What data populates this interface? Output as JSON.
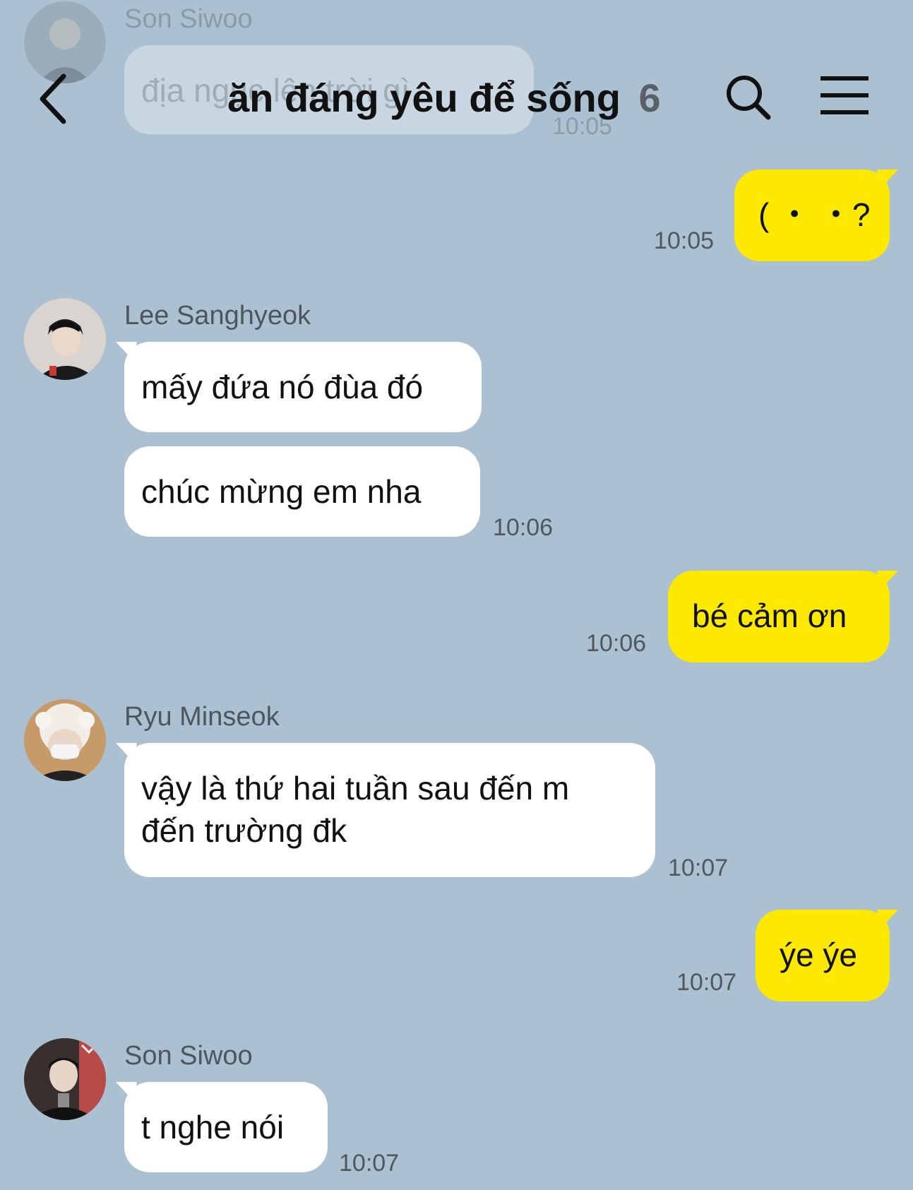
{
  "header": {
    "title": "ăn đáng yêu để sống",
    "member_count": "6"
  },
  "ghost_message": {
    "sender": "Son Siwoo",
    "text": "địa ngục lên trời gì",
    "time": "10:05"
  },
  "messages": [
    {
      "type": "out",
      "text": "( ・ ・?",
      "time": "10:05"
    },
    {
      "type": "in",
      "sender": "Lee Sanghyeok",
      "text": "mấy đứa nó đùa đó"
    },
    {
      "type": "in",
      "text": "chúc mừng em nha",
      "time": "10:06"
    },
    {
      "type": "out",
      "text": "bé cảm ơn",
      "time": "10:06"
    },
    {
      "type": "in",
      "sender": "Ryu Minseok",
      "line1": "vậy là thứ hai tuần sau đến m",
      "line2": "đến trường đk",
      "time": "10:07"
    },
    {
      "type": "out",
      "text": "ýe ýe",
      "time": "10:07"
    },
    {
      "type": "in",
      "sender": "Son Siwoo",
      "text": "t nghe nói",
      "time": "10:07"
    }
  ],
  "icons": {
    "back": "chevron-left-icon",
    "search": "search-icon",
    "menu": "hamburger-menu-icon"
  },
  "colors": {
    "background": "#abc1d1",
    "outgoing_bubble": "#fde800",
    "incoming_bubble": "#ffffff"
  }
}
